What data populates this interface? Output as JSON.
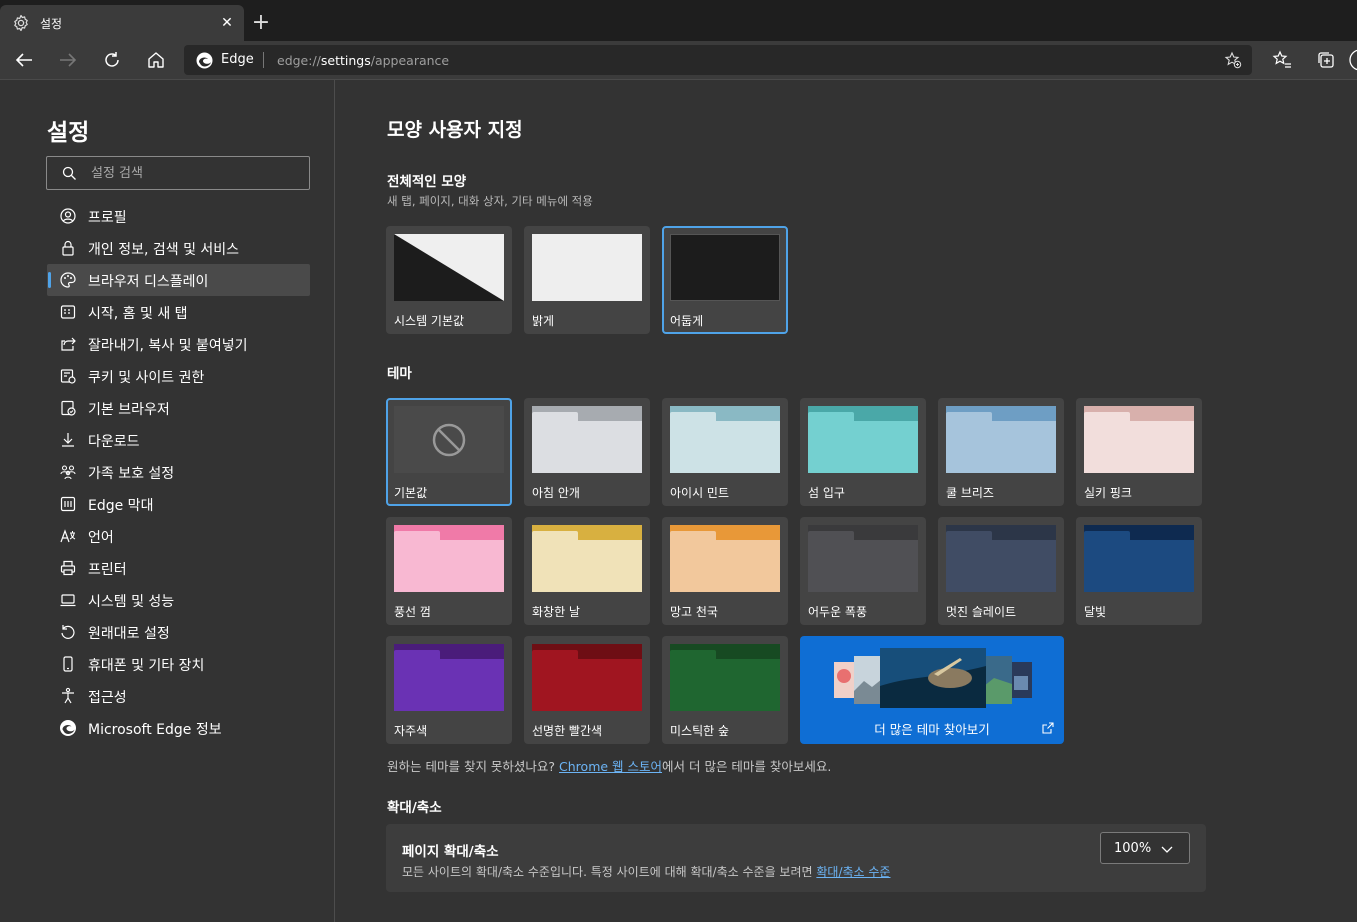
{
  "tab": {
    "title": "설정"
  },
  "toolbar": {
    "edge_label": "Edge",
    "url_prefix": "edge://",
    "url_bold": "settings",
    "url_suffix": "/appearance"
  },
  "sidebar": {
    "title": "설정",
    "search_placeholder": "설정 검색",
    "items": [
      {
        "label": "프로필",
        "icon": "profile-icon"
      },
      {
        "label": "개인 정보, 검색 및 서비스",
        "icon": "lock-icon"
      },
      {
        "label": "브라우저 디스플레이",
        "icon": "palette-icon",
        "active": true
      },
      {
        "label": "시작, 홈 및 새 탭",
        "icon": "home-grid-icon"
      },
      {
        "label": "잘라내기, 복사 및 붙여넣기",
        "icon": "share-icon"
      },
      {
        "label": "쿠키 및 사이트 권한",
        "icon": "cookie-icon"
      },
      {
        "label": "기본 브라우저",
        "icon": "browser-icon"
      },
      {
        "label": "다운로드",
        "icon": "download-icon"
      },
      {
        "label": "가족 보호 설정",
        "icon": "family-icon"
      },
      {
        "label": "Edge 막대",
        "icon": "edge-bar-icon"
      },
      {
        "label": "언어",
        "icon": "language-icon"
      },
      {
        "label": "프린터",
        "icon": "printer-icon"
      },
      {
        "label": "시스템 및 성능",
        "icon": "laptop-icon"
      },
      {
        "label": "원래대로 설정",
        "icon": "reset-icon"
      },
      {
        "label": "휴대폰 및 기타 장치",
        "icon": "phone-icon"
      },
      {
        "label": "접근성",
        "icon": "accessibility-icon"
      },
      {
        "label": "Microsoft Edge 정보",
        "icon": "edge-logo-icon"
      }
    ]
  },
  "main": {
    "title": "모양 사용자 지정",
    "overall": {
      "heading": "전체적인 모양",
      "subheading": "새 탭, 페이지, 대화 상자, 기타 메뉴에 적용",
      "options": [
        {
          "label": "시스템 기본값"
        },
        {
          "label": "밝게"
        },
        {
          "label": "어둡게",
          "selected": true
        }
      ]
    },
    "theme": {
      "heading": "테마",
      "items": [
        {
          "label": "기본값",
          "selected": true
        },
        {
          "label": "아침 안개",
          "tab": "#a7abb0",
          "body": "#dcdee2"
        },
        {
          "label": "아이시 민트",
          "tab": "#8ab9c4",
          "body": "#cde2e6"
        },
        {
          "label": "섬 입구",
          "tab": "#4aa8a8",
          "body": "#74d0d0"
        },
        {
          "label": "쿨 브리즈",
          "tab": "#6e9ec4",
          "body": "#a6c4dc"
        },
        {
          "label": "실키 핑크",
          "tab": "#d8b0ac",
          "body": "#f2dedc"
        },
        {
          "label": "풍선 껌",
          "tab": "#f07aa8",
          "body": "#f8b8d2"
        },
        {
          "label": "화창한 날",
          "tab": "#d8b040",
          "body": "#f0e2b8"
        },
        {
          "label": "망고 천국",
          "tab": "#e89838",
          "body": "#f2c89c"
        },
        {
          "label": "어두운 폭풍",
          "tab": "#3a3a3c",
          "body": "#505054"
        },
        {
          "label": "멋진 슬레이트",
          "tab": "#2c3648",
          "body": "#404c64"
        },
        {
          "label": "달빛",
          "tab": "#0e2a50",
          "body": "#1c4a80"
        },
        {
          "label": "자주색",
          "tab": "#4a1c7a",
          "body": "#6a32b4"
        },
        {
          "label": "선명한 빨간색",
          "tab": "#6e0e14",
          "body": "#a01520"
        },
        {
          "label": "미스틱한 숲",
          "tab": "#174a22",
          "body": "#1f6630"
        }
      ],
      "more_label": "더 많은 테마 찾아보기",
      "note_before": "원하는 테마를 찾지 못하셨나요? ",
      "note_link": "Chrome 웹 스토어",
      "note_after": "에서 더 많은 테마를 찾아보세요."
    },
    "zoom": {
      "heading": "확대/축소",
      "title": "페이지 확대/축소",
      "desc": "모든 사이트의 확대/축소 수준입니다. 특정 사이트에 대해 확대/축소 수준을 보려면 ",
      "desc_link": "확대/축소 수준",
      "value": "100%"
    }
  },
  "colors": {
    "accent": "#4fa3e8",
    "background": "#333333",
    "card": "#444444",
    "more_themes": "#0f6ed4"
  }
}
